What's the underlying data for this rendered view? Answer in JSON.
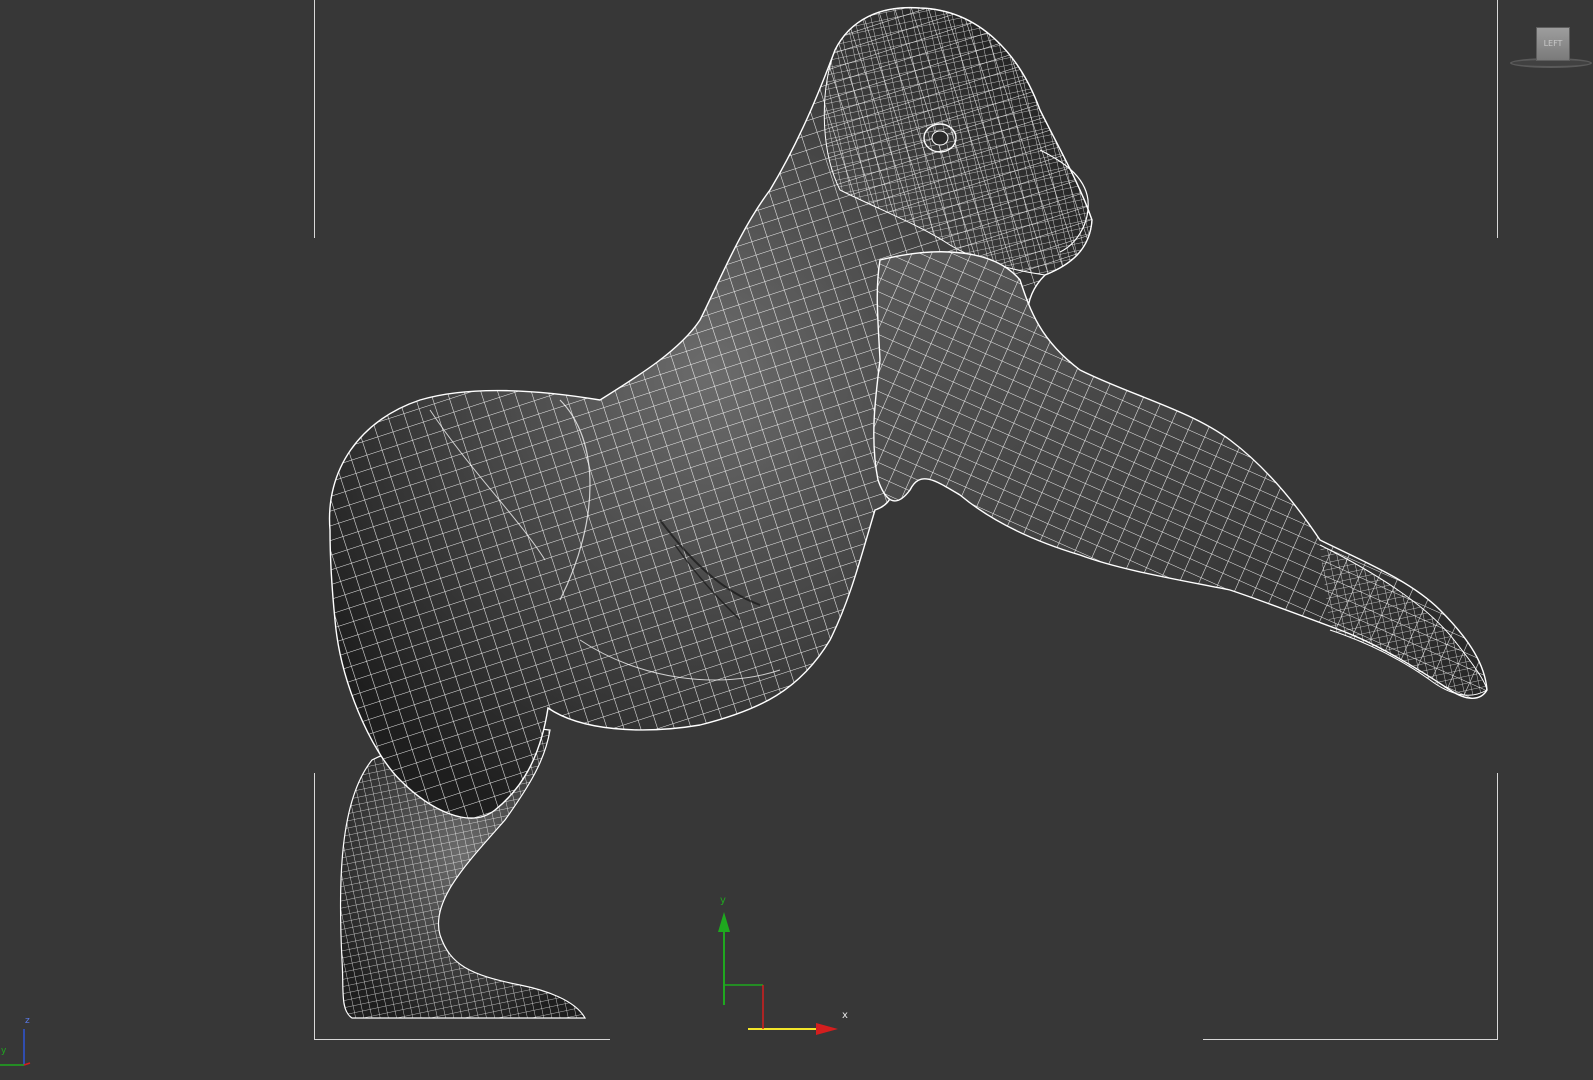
{
  "viewport": {
    "background_color": "#373737",
    "mesh_line_color": "#ffffff",
    "safe_frame_color": "#d8d8d8"
  },
  "viewcube": {
    "face_label": "LEFT",
    "icon": "viewcube-icon"
  },
  "axis_tripod": {
    "x_label": "x",
    "y_label": "y",
    "x_color": "#d41e1e",
    "y_color": "#1fa81f",
    "z_color": "#2f55d6"
  },
  "world_axis": {
    "z_label": "z",
    "y_label": "y"
  },
  "model": {
    "name_icon": "gorilla-wireframe-mesh"
  }
}
